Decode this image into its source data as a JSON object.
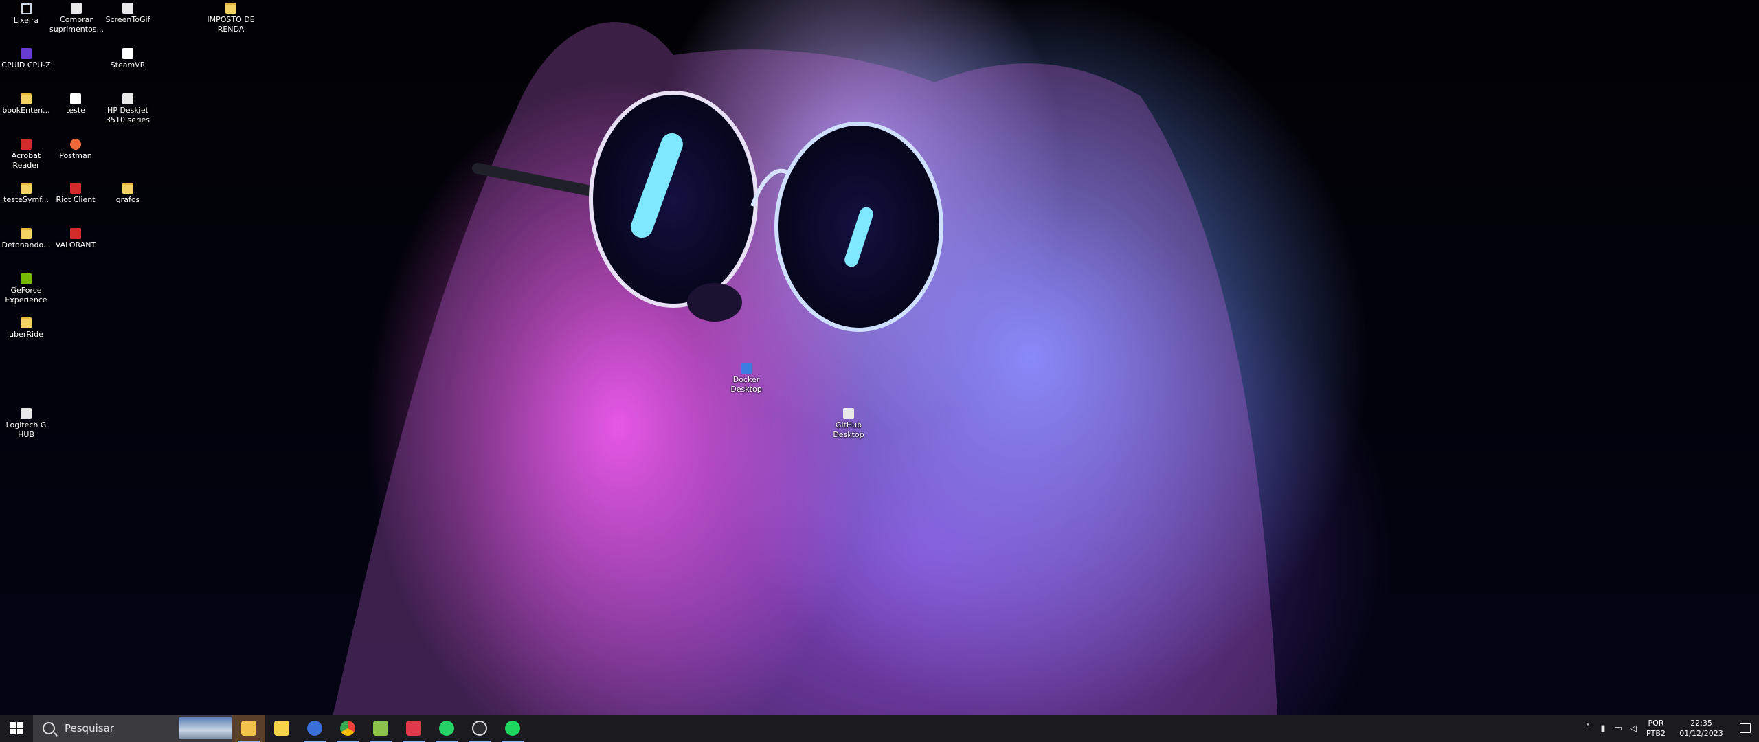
{
  "desktop": {
    "icons": [
      {
        "label": "Lixeira",
        "icon": "recycle-bin-icon"
      },
      {
        "label": "Comprar suprimentos...",
        "icon": "shortcut-icon"
      },
      {
        "label": "ScreenToGif",
        "icon": "app-icon"
      },
      {
        "label": "IMPOSTO DE RENDA",
        "icon": "folder-icon"
      },
      {
        "label": "CPUID CPU-Z",
        "icon": "app-icon"
      },
      {
        "label": "SteamVR",
        "icon": "document-icon"
      },
      {
        "label": "bookEnten...",
        "icon": "folder-icon"
      },
      {
        "label": "teste",
        "icon": "document-icon"
      },
      {
        "label": "HP Deskjet 3510 series",
        "icon": "printer-icon"
      },
      {
        "label": "Acrobat Reader",
        "icon": "acrobat-icon"
      },
      {
        "label": "Postman",
        "icon": "postman-icon"
      },
      {
        "label": "testeSymf...",
        "icon": "folder-icon"
      },
      {
        "label": "Riot Client",
        "icon": "riot-icon"
      },
      {
        "label": "grafos",
        "icon": "folder-icon"
      },
      {
        "label": "Detonando...",
        "icon": "folder-icon"
      },
      {
        "label": "VALORANT",
        "icon": "valorant-icon"
      },
      {
        "label": "GeForce Experience",
        "icon": "geforce-icon"
      },
      {
        "label": "uberRide",
        "icon": "folder-icon"
      },
      {
        "label": "Logitech G HUB",
        "icon": "logitech-icon"
      },
      {
        "label": "Docker Desktop",
        "icon": "docker-icon"
      },
      {
        "label": "GitHub Desktop",
        "icon": "github-icon"
      }
    ]
  },
  "taskbar": {
    "search_placeholder": "Pesquisar",
    "apps": [
      {
        "name": "File Explorer",
        "icon": "folder-icon",
        "active": true
      },
      {
        "name": "Sticky Notes",
        "icon": "notes-icon",
        "active": false
      },
      {
        "name": "Chrome Profile",
        "icon": "chrome-icon",
        "active": false
      },
      {
        "name": "Google Chrome",
        "icon": "chrome-icon",
        "active": false
      },
      {
        "name": "Notepad++",
        "icon": "notepad-icon",
        "active": false
      },
      {
        "name": "Pocket",
        "icon": "pocket-icon",
        "active": false
      },
      {
        "name": "WhatsApp",
        "icon": "whatsapp-icon",
        "active": false
      },
      {
        "name": "Logitech G HUB",
        "icon": "logitech-icon",
        "active": false
      },
      {
        "name": "Spotify",
        "icon": "spotify-icon",
        "active": false
      }
    ],
    "tray": {
      "language_1": "POR",
      "language_2": "PTB2",
      "time": "22:35",
      "date": "01/12/2023"
    }
  },
  "colors": {
    "taskbar_bg": "#1b1b1f",
    "search_bg": "#3b3b3f",
    "active_app_bg": "#5a3f2a",
    "wallpaper_pink": "#f050e6",
    "wallpaper_blue": "#6e96ff"
  }
}
